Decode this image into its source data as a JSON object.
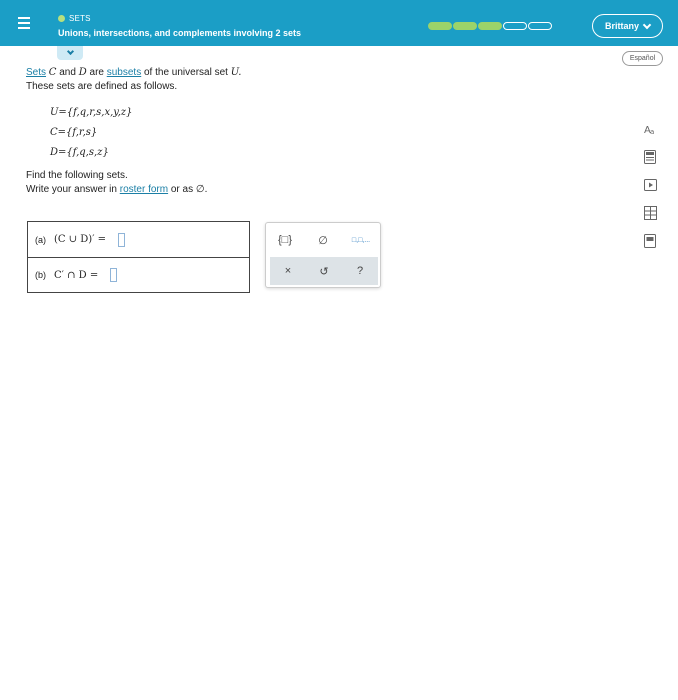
{
  "header": {
    "topic": "SETS",
    "lesson_title": "Unions, intersections, and complements involving 2 sets",
    "user_name": "Brittany",
    "progress": {
      "filled": 3,
      "total": 5
    }
  },
  "language_button": "Español",
  "problem": {
    "sets_link": "Sets",
    "var_c": "C",
    "and": "and",
    "var_d": "D",
    "are": "are",
    "subsets_link": "subsets",
    "of_universal": "of the universal set",
    "var_u": "U.",
    "defined": "These sets are defined as follows.",
    "set_u": "U={f,q,r,s,x,y,z}",
    "set_c": "C={f,r,s}",
    "set_d": "D={f,q,s,z}",
    "find": "Find the following sets.",
    "write_prefix": "Write your answer in",
    "roster_link": "roster form",
    "write_suffix": "or as ∅."
  },
  "answers": [
    {
      "label": "(a)",
      "expr": "(C ∪ D)′ ="
    },
    {
      "label": "(b)",
      "expr": "C′ ∩ D ="
    }
  ],
  "palette": {
    "braces": "{□}",
    "empty_set": "∅",
    "list": "□,□,...",
    "clear": "×",
    "undo": "↺",
    "help": "?"
  },
  "side_tools": [
    "text-to-speech-icon",
    "calculator-icon",
    "video-icon",
    "data-icon",
    "textbook-icon"
  ]
}
